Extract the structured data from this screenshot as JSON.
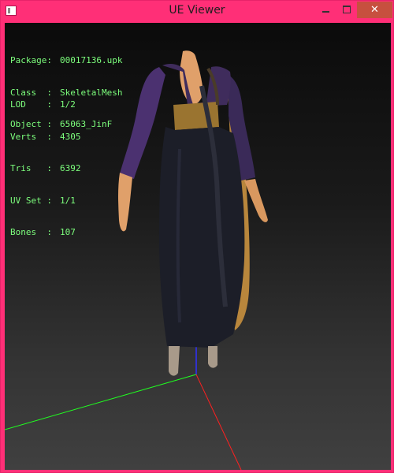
{
  "window": {
    "title": "UE Viewer",
    "close_glyph": "✕",
    "icons": {
      "app": "app-window-icon",
      "minimize": "minimize-icon",
      "maximize": "maximize-icon",
      "close": "close-icon"
    },
    "accent_color": "#ff2f77"
  },
  "overlay": {
    "text_color": "#7dff7d",
    "package": {
      "key": "Package:",
      "value": "00017136.upk"
    },
    "class": {
      "key": "Class  :",
      "value": "SkeletalMesh"
    },
    "object": {
      "key": "Object :",
      "value": "65063_JinF"
    },
    "lod": {
      "key": "LOD    :",
      "value": "1/2"
    },
    "verts": {
      "key": "Verts  :",
      "value": "4305"
    },
    "tris": {
      "key": "Tris   :",
      "value": "6392"
    },
    "uvset": {
      "key": "UV Set :",
      "value": "1/1"
    },
    "bones": {
      "key": "Bones  :",
      "value": "107"
    }
  },
  "axes": {
    "x_color": "#ff2020",
    "y_color": "#20ff20",
    "z_color": "#3030ff"
  },
  "model": {
    "garment_color": "#1c1e28",
    "sleeve_color": "#4b3170",
    "skin_color": "#e0a06a",
    "hair_color": "#b8863c",
    "sash_color": "#9a7430"
  }
}
